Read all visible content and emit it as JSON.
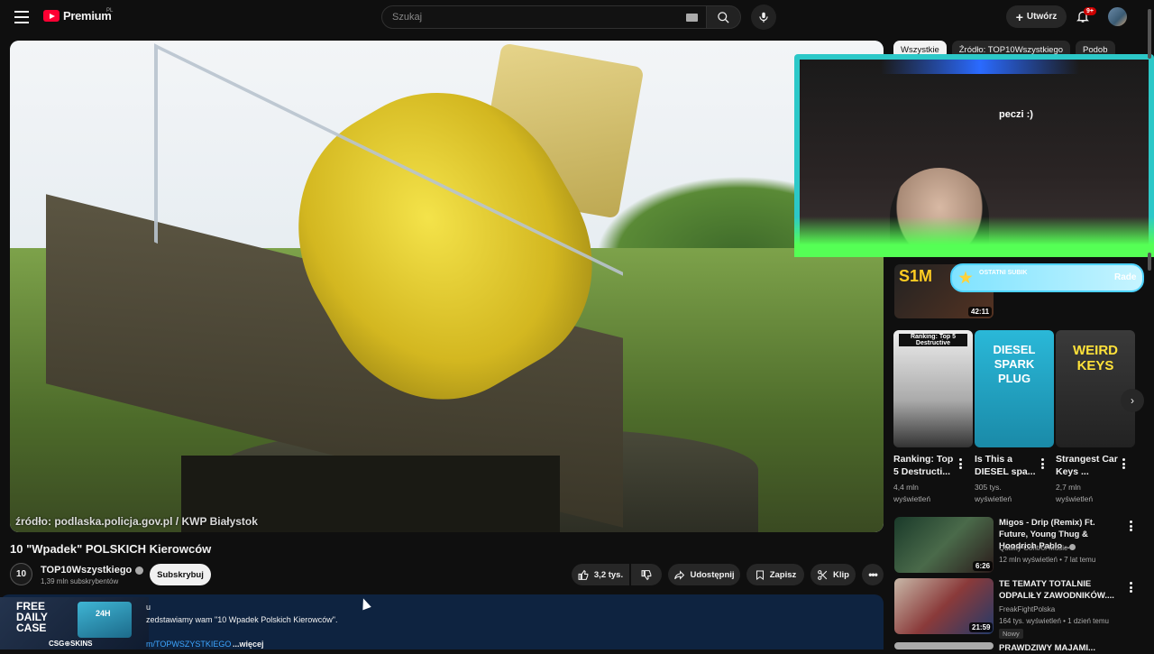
{
  "header": {
    "logo_text": "Premium",
    "logo_sup": "PL",
    "search_placeholder": "Szukaj",
    "create_label": "Utwórz",
    "notifications_badge": "9+"
  },
  "player": {
    "watermark": "źródło: podlaska.policja.gov.pl / KWP Białystok"
  },
  "video": {
    "title": "10 \"Wpadek\" POLSKICH Kierowców",
    "channel_name": "TOP10Wszystkiego",
    "channel_avatar_text": "10",
    "subscribers": "1,39 mln subskrybentów",
    "subscribe_label": "Subskrybuj",
    "likes": "3,2 tys.",
    "share_label": "Udostępnij",
    "save_label": "Zapisz",
    "clip_label": "Klip"
  },
  "description": {
    "first_line": "u",
    "text": "zedstawiamy wam \"10 Wpadek Polskich Kierowców\".",
    "link": "m/TOPWSZYSTKIEGO",
    "more": "...więcej"
  },
  "ad": {
    "line1": "FREE DAILY CASE",
    "box_label": "24H",
    "line2": "CSG⊕SKINS"
  },
  "chips": [
    "Wszystkie",
    "Źródło: TOP10Wszystkiego",
    "Podob"
  ],
  "overlay": {
    "cam_text": "peczi :)",
    "alert_title": "OSTATNI SUBIK",
    "alert_name": "Rade",
    "s1_text": "S1M"
  },
  "first_rec_duration": "42:11",
  "shorts": [
    {
      "thumb_text": "Ranking: Top 5 Destructive",
      "title": "Ranking: Top 5 Destructi...",
      "views": "4,4 mln",
      "suffix": "wyświetleń",
      "color": "#ffffff"
    },
    {
      "thumb_text": "DIESEL SPARK PLUG",
      "title": "Is This a DIESEL spa...",
      "views": "305 tys.",
      "suffix": "wyświetleń",
      "color": "#28a8c8"
    },
    {
      "thumb_text": "WEIRD KEYS",
      "title": "Strangest Car Keys ...",
      "views": "2,7 mln",
      "suffix": "wyświetleń",
      "color": "#2a2a2a"
    }
  ],
  "recommendations": [
    {
      "title": "Migos - Drip (Remix) Ft. Future, Young Thug & Hoodrich Pablo ...",
      "channel": "Quality Control Music",
      "meta": "12 mln wyświetleń • 7 lat temu",
      "duration": "6:26"
    },
    {
      "title": "TE TEMATY TOTALNIE ODPALIŁY ZAWODNIKÓW....",
      "channel": "FreakFightPolska",
      "meta": "164 tys. wyświetleń • 1 dzień temu",
      "duration": "21:59",
      "badge": "Nowy"
    },
    {
      "title": "PRAWDZIWY MAJAMI...",
      "channel": "",
      "meta": "",
      "duration": ""
    }
  ]
}
